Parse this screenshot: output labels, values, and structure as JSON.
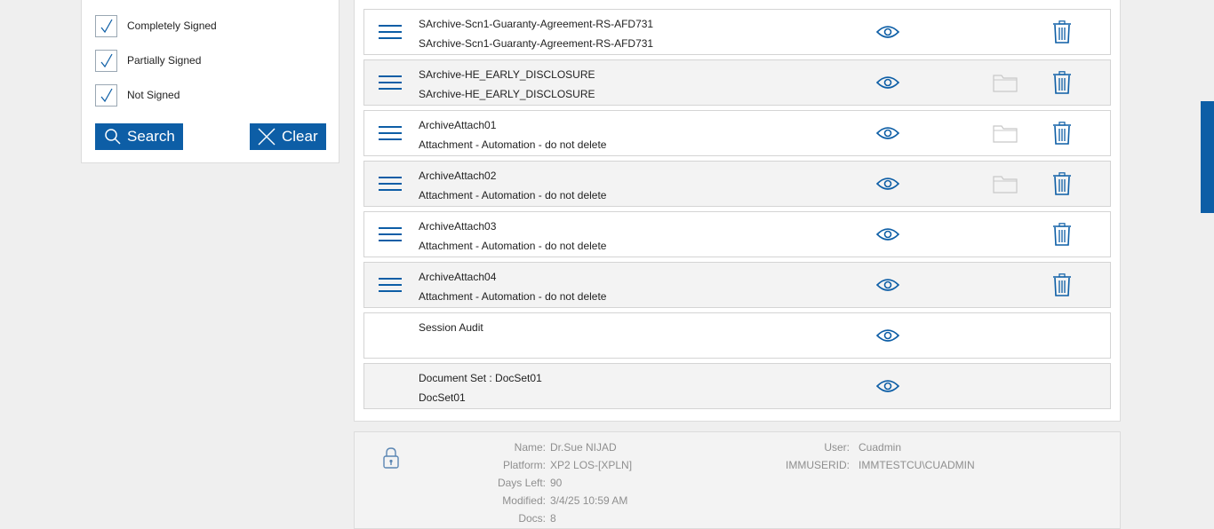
{
  "filters": {
    "checkboxes": [
      {
        "label": "Completely Signed",
        "checked": true
      },
      {
        "label": "Partially Signed",
        "checked": true
      },
      {
        "label": "Not Signed",
        "checked": true
      }
    ],
    "search_label": "Search",
    "clear_label": "Clear"
  },
  "documents": [
    {
      "title": "SArchive-Scn1-Guaranty-Agreement-RS-AFD731",
      "subtitle": "SArchive-Scn1-Guaranty-Agreement-RS-AFD731"
    },
    {
      "title": "SArchive-HE_EARLY_DISCLOSURE",
      "subtitle": "SArchive-HE_EARLY_DISCLOSURE"
    },
    {
      "title": "ArchiveAttach01",
      "subtitle": "Attachment - Automation - do not delete"
    },
    {
      "title": "ArchiveAttach02",
      "subtitle": "Attachment - Automation - do not delete"
    },
    {
      "title": "ArchiveAttach03",
      "subtitle": "Attachment - Automation - do not delete"
    },
    {
      "title": "ArchiveAttach04",
      "subtitle": "Attachment - Automation - do not delete"
    },
    {
      "title": "Session Audit",
      "subtitle": ""
    },
    {
      "title": "Document Set : DocSet01",
      "subtitle": "DocSet01"
    }
  ],
  "session_info": {
    "name_label": "Name:",
    "name": "Dr.Sue NIJAD",
    "platform_label": "Platform:",
    "platform": "XP2 LOS-[XPLN]",
    "days_left_label": "Days Left:",
    "days_left": "90",
    "modified_label": "Modified:",
    "modified": "3/4/25 10:59 AM",
    "docs_label": "Docs:",
    "docs": "8",
    "user_label": "User:",
    "user": "Cuadmin",
    "immuserid_label": "IMMUSERID:",
    "immuserid": "IMMTESTCU\\CUADMIN"
  },
  "colors": {
    "accent": "#0d5ea6",
    "muted_text": "#8f8f8f"
  }
}
